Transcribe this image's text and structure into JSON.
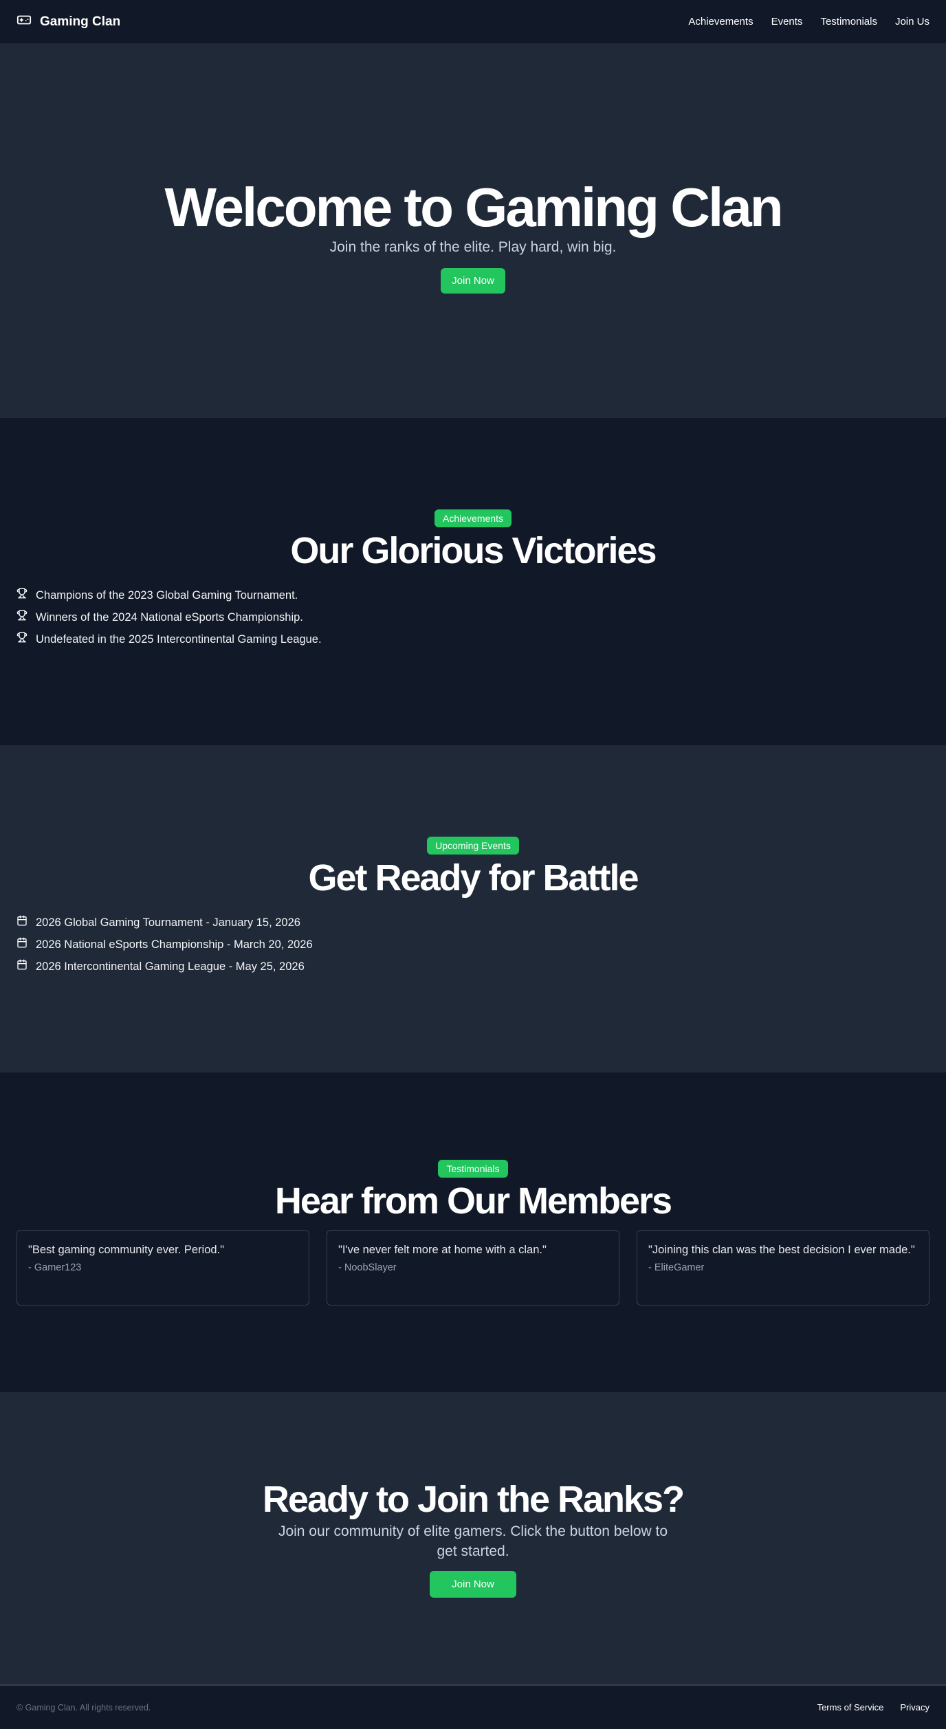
{
  "header": {
    "brand": "Gaming Clan",
    "nav": [
      "Achievements",
      "Events",
      "Testimonials",
      "Join Us"
    ]
  },
  "hero": {
    "title": "Welcome to Gaming Clan",
    "subtitle": "Join the ranks of the elite. Play hard, win big.",
    "button": "Join Now"
  },
  "achievements": {
    "badge": "Achievements",
    "title": "Our Glorious Victories",
    "items": [
      "Champions of the 2023 Global Gaming Tournament.",
      "Winners of the 2024 National eSports Championship.",
      "Undefeated in the 2025 Intercontinental Gaming League."
    ]
  },
  "events": {
    "badge": "Upcoming Events",
    "title": "Get Ready for Battle",
    "items": [
      "2026 Global Gaming Tournament - January 15, 2026",
      "2026 National eSports Championship - March 20, 2026",
      "2026 Intercontinental Gaming League - May 25, 2026"
    ]
  },
  "testimonials": {
    "badge": "Testimonials",
    "title": "Hear from Our Members",
    "items": [
      {
        "quote": "\"Best gaming community ever. Period.\"",
        "author": "- Gamer123"
      },
      {
        "quote": "\"I've never felt more at home with a clan.\"",
        "author": "- NoobSlayer"
      },
      {
        "quote": "\"Joining this clan was the best decision I ever made.\"",
        "author": "- EliteGamer"
      }
    ]
  },
  "cta": {
    "title": "Ready to Join the Ranks?",
    "subtitle": "Join our community of elite gamers. Click the button below to get started.",
    "button": "Join Now"
  },
  "footer": {
    "copyright": "© Gaming Clan. All rights reserved.",
    "links": [
      "Terms of Service",
      "Privacy"
    ]
  },
  "colors": {
    "accent": "#22c55e",
    "bg_dark": "#111827",
    "bg_mid": "#1f2937"
  },
  "icons": {
    "brand": "gamepad-icon",
    "achievement": "trophy-icon",
    "event": "calendar-icon"
  }
}
